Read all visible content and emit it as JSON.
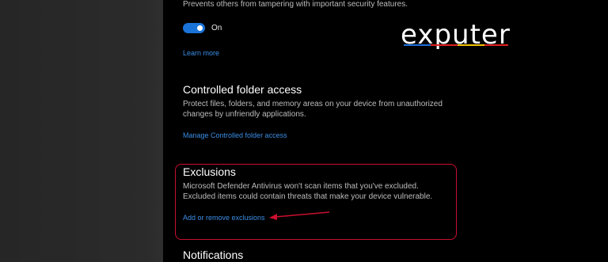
{
  "tamper_protection": {
    "description": "Prevents others from tampering with important security features.",
    "toggle_label": "On",
    "toggle_state": "on",
    "learn_more": "Learn more"
  },
  "controlled_folder_access": {
    "title": "Controlled folder access",
    "description_line1": "Protect files, folders, and memory areas on your device from unauthorized",
    "description_line2": "changes by unfriendly applications.",
    "link": "Manage Controlled folder access"
  },
  "exclusions": {
    "title": "Exclusions",
    "description_line1": "Microsoft Defender Antivirus won't scan items that you've excluded.",
    "description_line2": "Excluded items could contain threats that make your device vulnerable.",
    "link": "Add or remove exclusions"
  },
  "notifications": {
    "title": "Notifications"
  },
  "watermark": {
    "text": "exputer"
  },
  "colors": {
    "background": "#000000",
    "left_strip": "#2a2a2a",
    "link": "#3a8ee6",
    "toggle_on": "#1a73d9",
    "annotation_red": "#c8102e",
    "logo_stripe_blue": "#1e6fd9",
    "logo_stripe_red": "#e02020",
    "logo_stripe_yellow": "#f2c200"
  }
}
